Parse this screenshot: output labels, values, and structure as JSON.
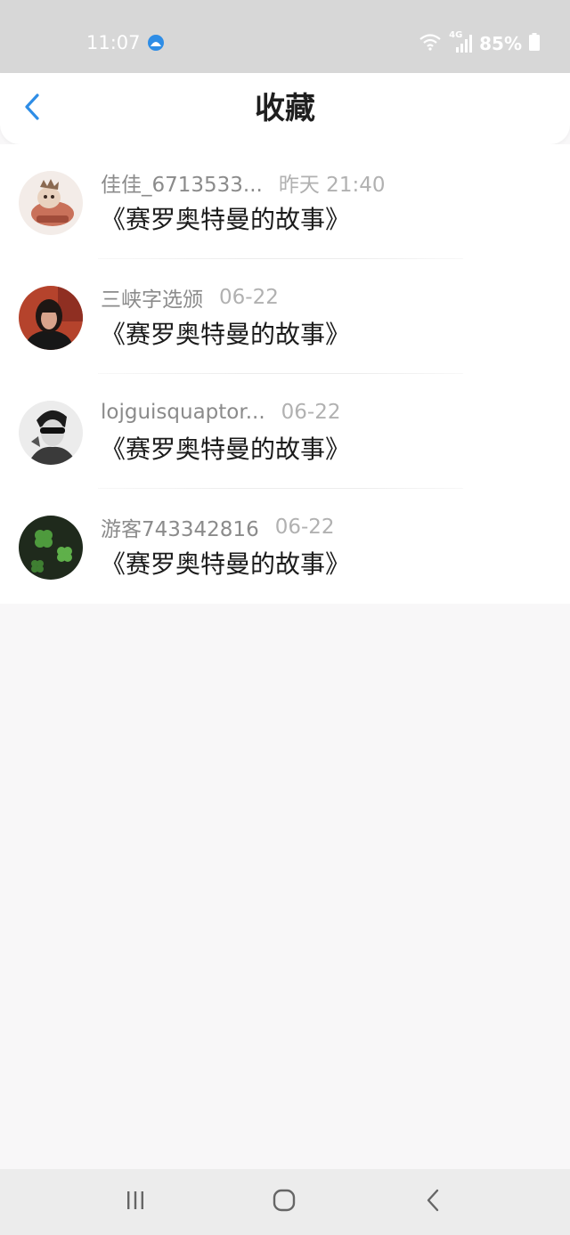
{
  "status_bar": {
    "time": "11:07",
    "battery": "85%",
    "network": "4G"
  },
  "header": {
    "title": "收藏",
    "back_icon": "chevron-left-icon"
  },
  "favorites": [
    {
      "username": "佳佳_6713533...",
      "date": "昨天 21:40",
      "title": "《赛罗奥特曼的故事》",
      "avatar": "cartoon-character-avatar"
    },
    {
      "username": "三峡字选颁",
      "date": "06-22",
      "title": "《赛罗奥特曼的故事》",
      "avatar": "woman-portrait-avatar"
    },
    {
      "username": "lojguisquaptor...",
      "date": "06-22",
      "title": "《赛罗奥特曼的故事》",
      "avatar": "sunglasses-portrait-avatar"
    },
    {
      "username": "游客743342816",
      "date": "06-22",
      "title": "《赛罗奥特曼的故事》",
      "avatar": "clover-avatar"
    }
  ],
  "nav_bar": {
    "recent_icon": "recent-apps-icon",
    "home_icon": "home-icon",
    "back_icon": "back-icon"
  },
  "colors": {
    "accent": "#2e8de6",
    "status_bar_bg": "#d7d7d7",
    "page_bg": "#f8f7f8"
  }
}
